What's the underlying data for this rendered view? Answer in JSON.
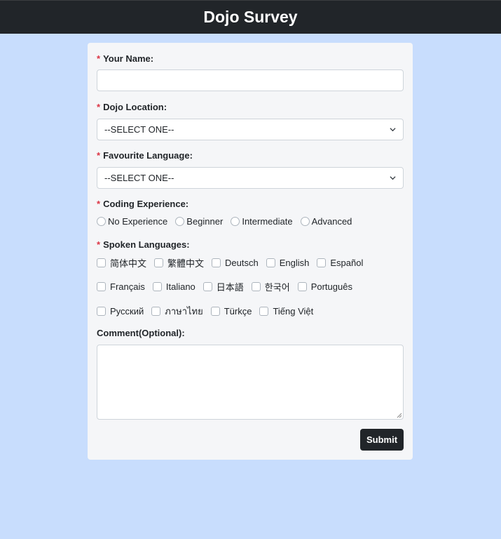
{
  "header": {
    "title": "Dojo Survey"
  },
  "form": {
    "name": {
      "label": "Your Name:",
      "required_mark": "*",
      "value": ""
    },
    "location": {
      "label": "Dojo Location:",
      "required_mark": "*",
      "selected": "--SELECT ONE--"
    },
    "language": {
      "label": "Favourite Language:",
      "required_mark": "*",
      "selected": "--SELECT ONE--"
    },
    "experience": {
      "label": "Coding Experience:",
      "required_mark": "*",
      "options": [
        "No Experience",
        "Beginner",
        "Intermediate",
        "Advanced"
      ]
    },
    "spoken": {
      "label": "Spoken Languages:",
      "required_mark": "*",
      "rows": [
        [
          "简体中文",
          "繁體中文",
          "Deutsch",
          "English",
          "Español"
        ],
        [
          "Français",
          "Italiano",
          "日本語",
          "한국어",
          "Português"
        ],
        [
          "Русский",
          "ภาษาไทย",
          "Türkçe",
          "Tiếng Việt"
        ]
      ]
    },
    "comment": {
      "label": "Comment(Optional):",
      "value": ""
    },
    "submit_label": "Submit"
  },
  "colors": {
    "header_bg": "#212529",
    "page_bg": "#c8ddfd",
    "card_bg": "#f5f6f8",
    "required": "#dc3545",
    "button_bg": "#212529"
  }
}
